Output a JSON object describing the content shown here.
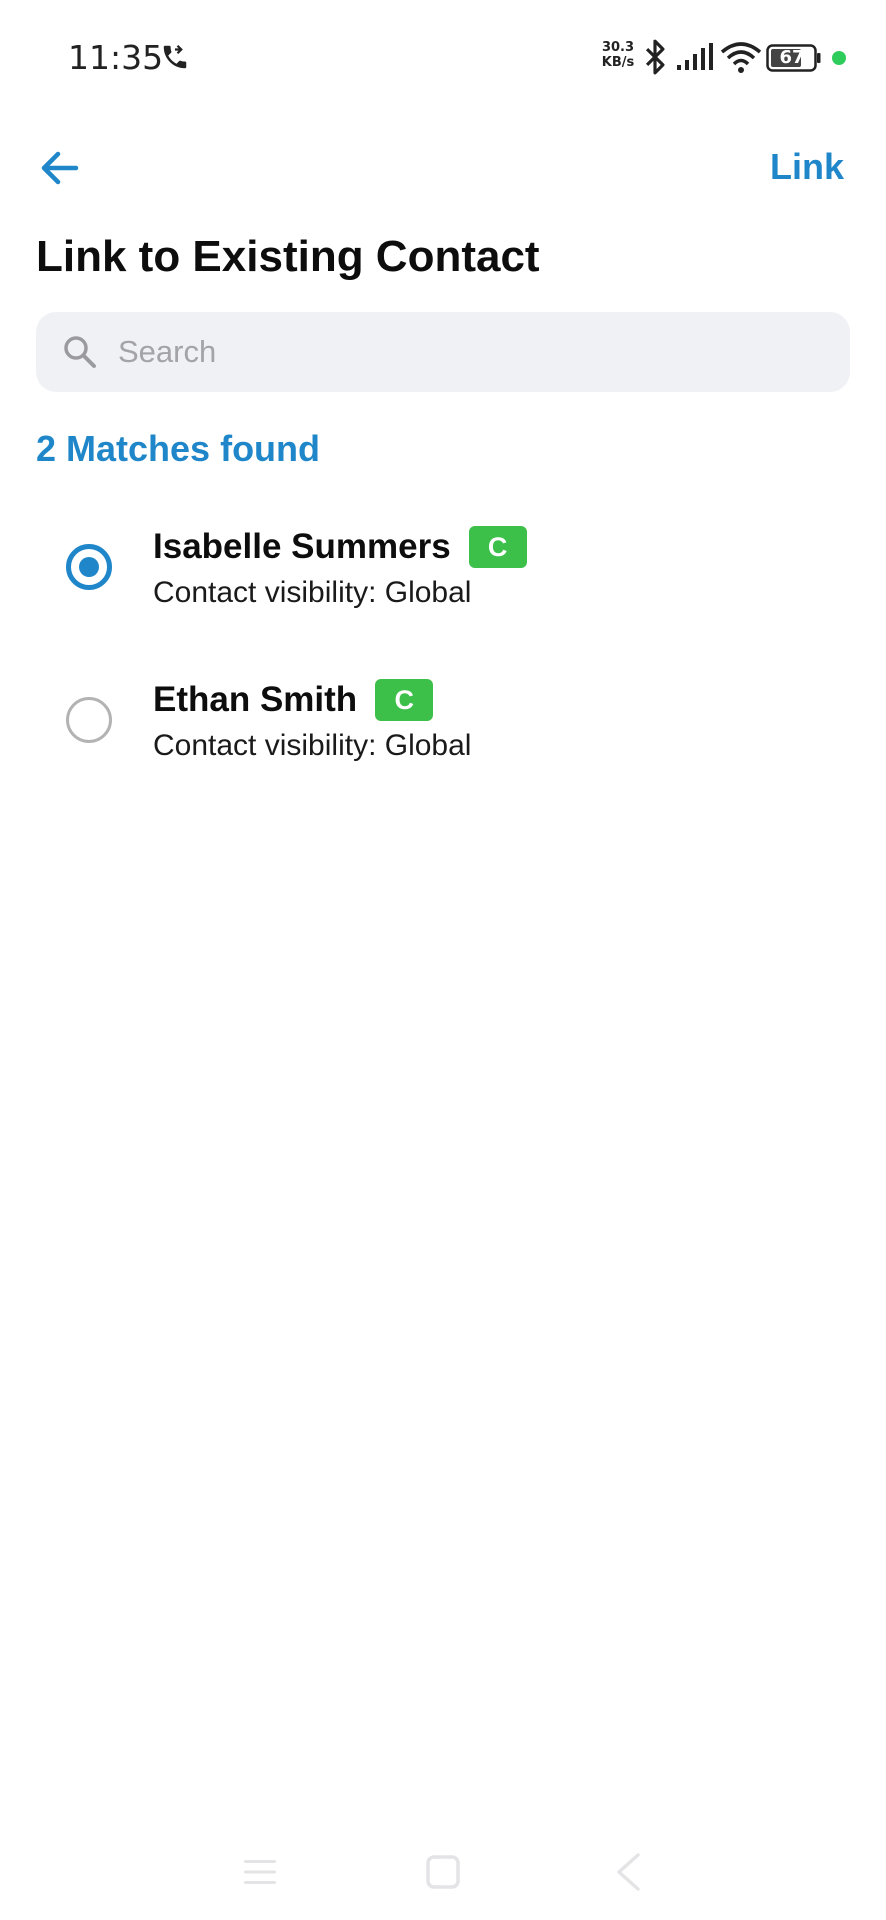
{
  "status_bar": {
    "time": "11:35",
    "net_speed_value": "30.3",
    "net_speed_unit": "KB/s",
    "battery_level": "67",
    "icons": [
      "call-icon",
      "bluetooth-icon",
      "signal-icon",
      "wifi-icon",
      "battery-icon"
    ],
    "dot_color": "#2ecc5a"
  },
  "header": {
    "back_icon": "arrow-left-icon",
    "link_label": "Link",
    "title": "Link to Existing Contact"
  },
  "search": {
    "placeholder": "Search",
    "value": ""
  },
  "matches": {
    "label": "2 Matches found",
    "items": [
      {
        "name": "Isabelle Summers",
        "badge": "C",
        "visibility": "Contact visibility: Global",
        "selected": true
      },
      {
        "name": "Ethan Smith",
        "badge": "C",
        "visibility": "Contact visibility: Global",
        "selected": false
      }
    ]
  },
  "colors": {
    "accent": "#1f87c9",
    "badge": "#3cc04a",
    "search_bg": "#f0f1f5"
  },
  "nav_bar": {
    "icons": [
      "menu-icon",
      "home-icon",
      "back-icon"
    ]
  }
}
